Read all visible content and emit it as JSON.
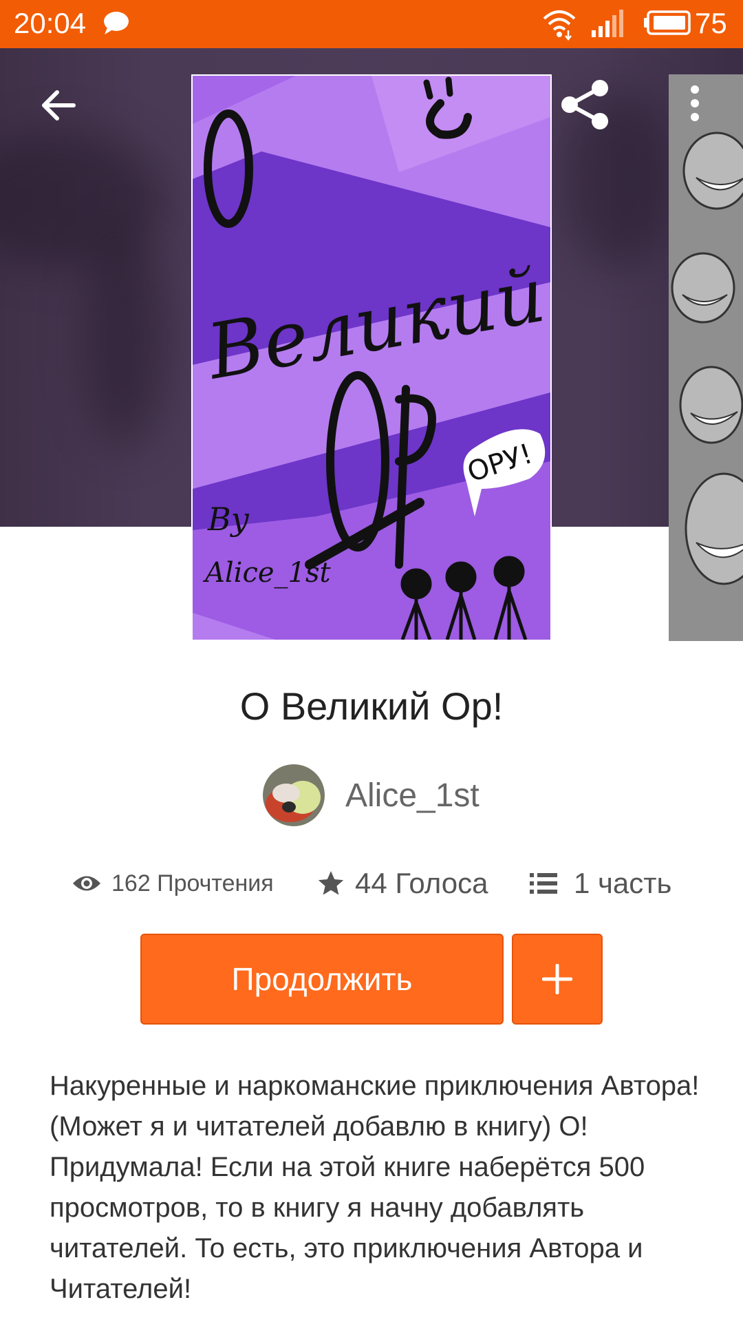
{
  "status_bar": {
    "time": "20:04",
    "battery": "75",
    "background_color": "#f25c05",
    "icons": [
      "chat-icon",
      "wifi-icon",
      "signal-icon",
      "battery-icon"
    ]
  },
  "header": {
    "back_icon": "arrow-left-icon",
    "share_icon": "share-icon",
    "more_icon": "more-vertical-icon"
  },
  "cover": {
    "lettering": [
      "О",
      "Великий",
      "Ор",
      "ОРУ!",
      "By",
      "Alice_1st"
    ],
    "colors": {
      "light": "#b57cf0",
      "mid": "#9d5ce3",
      "dark": "#6d35c8"
    }
  },
  "story": {
    "title": "О Великий Ор!",
    "author": "Alice_1st",
    "stats": {
      "reads": "162 Прочтения",
      "votes": "44 Голоса",
      "parts": "1 часть"
    },
    "stat_icons": [
      "eye-icon",
      "star-icon",
      "list-icon"
    ],
    "continue_label": "Продолжить",
    "add_label": "+",
    "description": "Накуренные и наркоманские приключения Автора! (Может я и читателей добавлю в книгу) О! Придумала! Если на этой книге наберётся 500 просмотров, то в книгу я начну добавлять читателей. То есть, это приключения Автора и Читателей!"
  },
  "colors": {
    "accent": "#ff6a1c",
    "accent_border": "#e6540b",
    "header_bg": "#4a3a55"
  }
}
